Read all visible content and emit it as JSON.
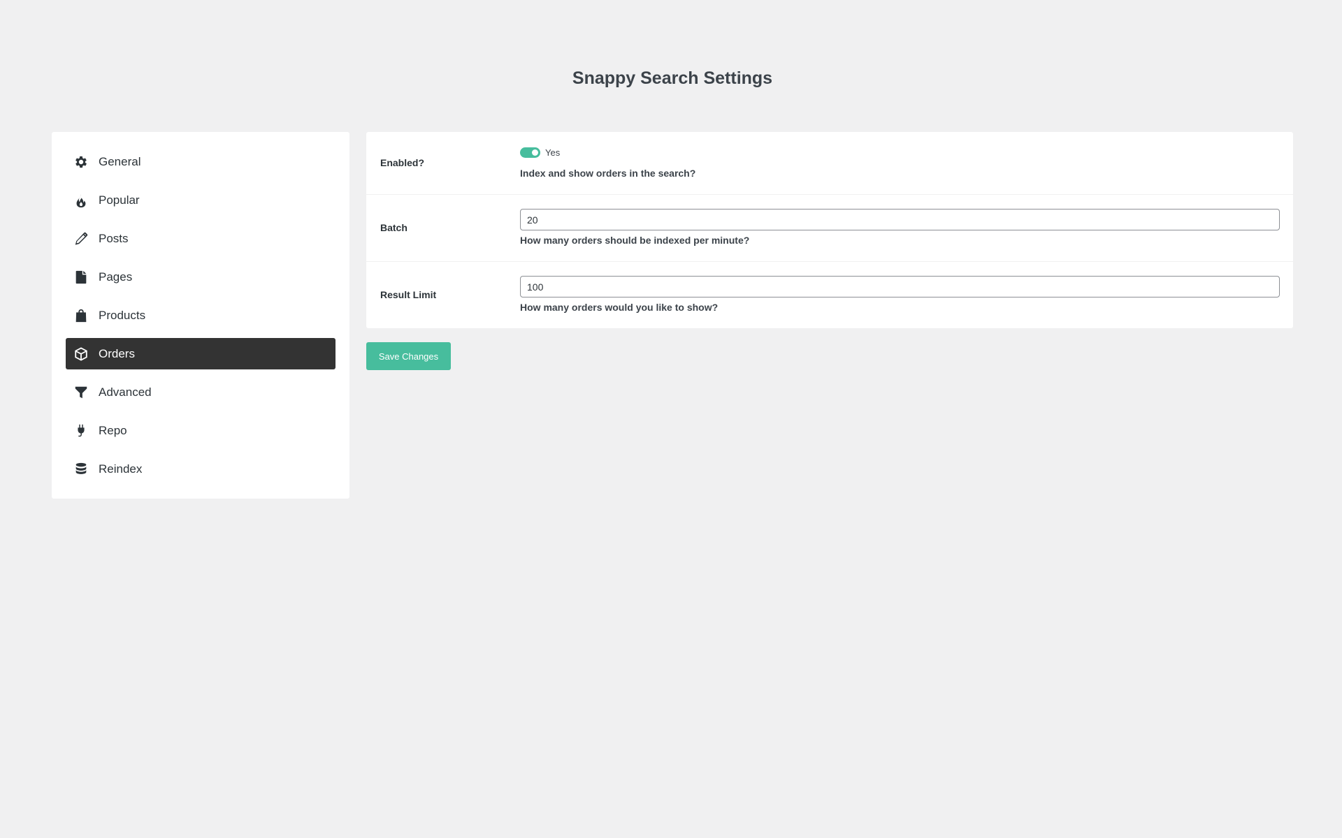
{
  "page": {
    "title": "Snappy Search Settings"
  },
  "sidebar": {
    "items": [
      {
        "label": "General",
        "icon": "gear-icon",
        "active": false
      },
      {
        "label": "Popular",
        "icon": "fire-icon",
        "active": false
      },
      {
        "label": "Posts",
        "icon": "pencil-icon",
        "active": false
      },
      {
        "label": "Pages",
        "icon": "document-icon",
        "active": false
      },
      {
        "label": "Products",
        "icon": "shopping-bag-icon",
        "active": false
      },
      {
        "label": "Orders",
        "icon": "box-icon",
        "active": true
      },
      {
        "label": "Advanced",
        "icon": "filter-icon",
        "active": false
      },
      {
        "label": "Repo",
        "icon": "plug-icon",
        "active": false
      },
      {
        "label": "Reindex",
        "icon": "database-icon",
        "active": false
      }
    ]
  },
  "settings": {
    "enabled": {
      "label": "Enabled?",
      "toggle_label": "Yes",
      "checked": true,
      "description": "Index and show orders in the search?"
    },
    "batch": {
      "label": "Batch",
      "value": "20",
      "description": "How many orders should be indexed per minute?"
    },
    "result_limit": {
      "label": "Result Limit",
      "value": "100",
      "description": "How many orders would you like to show?"
    }
  },
  "actions": {
    "save_label": "Save Changes"
  },
  "colors": {
    "accent": "#47bd9d",
    "active_nav": "#333333",
    "background": "#f0f0f1"
  }
}
